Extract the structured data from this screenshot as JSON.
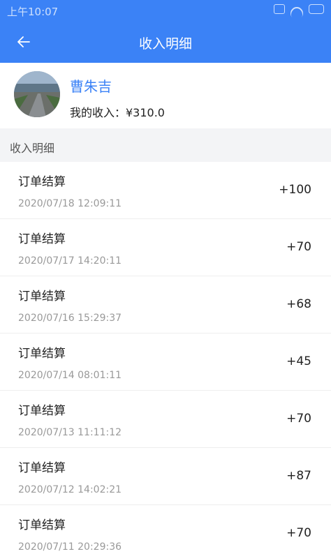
{
  "status_bar": {
    "time": "上午10:07"
  },
  "nav": {
    "title": "收入明细",
    "back_icon": "arrow-left-icon"
  },
  "profile": {
    "name": "曹朱吉",
    "income_label": "我的收入：¥310.0"
  },
  "section": {
    "label": "收入明细"
  },
  "records": [
    {
      "name": "订单结算",
      "date": "2020/07/18 12:09:11",
      "amount": "+100"
    },
    {
      "name": "订单结算",
      "date": "2020/07/17 14:20:11",
      "amount": "+70"
    },
    {
      "name": "订单结算",
      "date": "2020/07/16 15:29:37",
      "amount": "+68"
    },
    {
      "name": "订单结算",
      "date": "2020/07/14 08:01:11",
      "amount": "+45"
    },
    {
      "name": "订单结算",
      "date": "2020/07/13 11:11:12",
      "amount": "+70"
    },
    {
      "name": "订单结算",
      "date": "2020/07/12 14:02:21",
      "amount": "+87"
    },
    {
      "name": "订单结算",
      "date": "2020/07/11 20:29:36",
      "amount": "+70"
    }
  ],
  "colors": {
    "primary": "#3b82f6",
    "section_bg": "#f3f4f6"
  }
}
